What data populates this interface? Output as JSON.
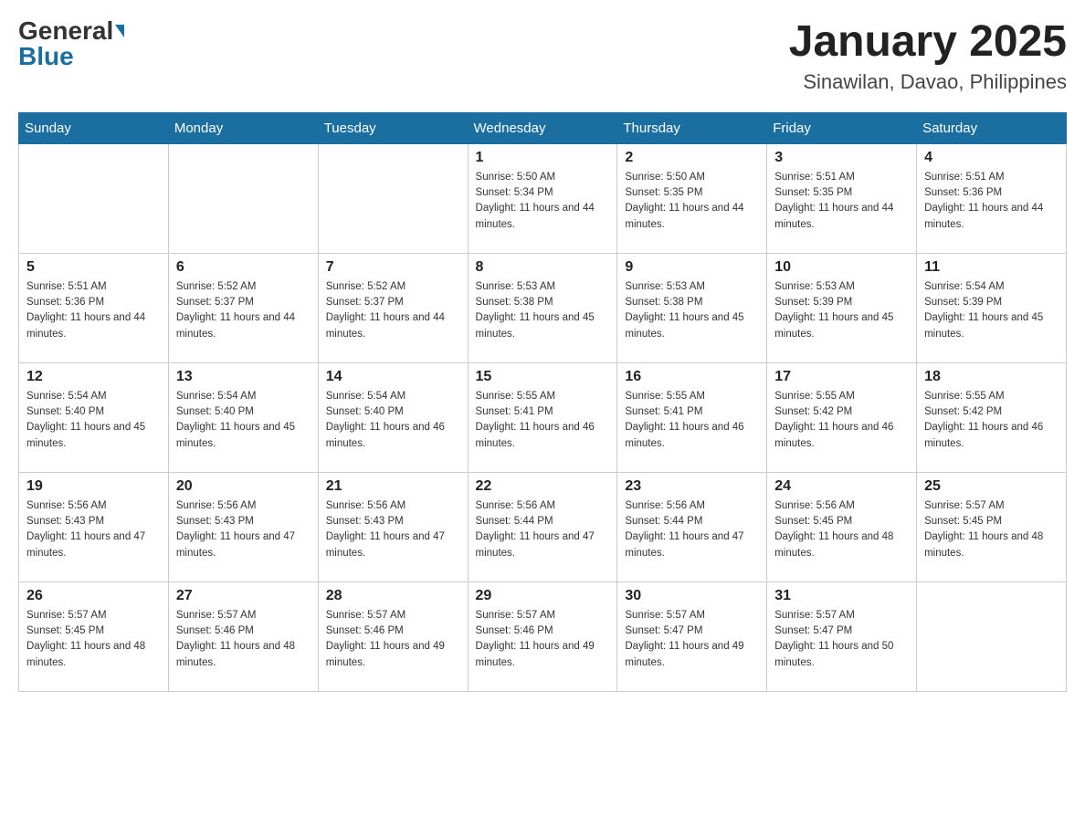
{
  "header": {
    "logo_general": "General",
    "logo_blue": "Blue",
    "month_title": "January 2025",
    "location": "Sinawilan, Davao, Philippines"
  },
  "days_of_week": [
    "Sunday",
    "Monday",
    "Tuesday",
    "Wednesday",
    "Thursday",
    "Friday",
    "Saturday"
  ],
  "weeks": [
    [
      {
        "day": "",
        "info": ""
      },
      {
        "day": "",
        "info": ""
      },
      {
        "day": "",
        "info": ""
      },
      {
        "day": "1",
        "info": "Sunrise: 5:50 AM\nSunset: 5:34 PM\nDaylight: 11 hours and 44 minutes."
      },
      {
        "day": "2",
        "info": "Sunrise: 5:50 AM\nSunset: 5:35 PM\nDaylight: 11 hours and 44 minutes."
      },
      {
        "day": "3",
        "info": "Sunrise: 5:51 AM\nSunset: 5:35 PM\nDaylight: 11 hours and 44 minutes."
      },
      {
        "day": "4",
        "info": "Sunrise: 5:51 AM\nSunset: 5:36 PM\nDaylight: 11 hours and 44 minutes."
      }
    ],
    [
      {
        "day": "5",
        "info": "Sunrise: 5:51 AM\nSunset: 5:36 PM\nDaylight: 11 hours and 44 minutes."
      },
      {
        "day": "6",
        "info": "Sunrise: 5:52 AM\nSunset: 5:37 PM\nDaylight: 11 hours and 44 minutes."
      },
      {
        "day": "7",
        "info": "Sunrise: 5:52 AM\nSunset: 5:37 PM\nDaylight: 11 hours and 44 minutes."
      },
      {
        "day": "8",
        "info": "Sunrise: 5:53 AM\nSunset: 5:38 PM\nDaylight: 11 hours and 45 minutes."
      },
      {
        "day": "9",
        "info": "Sunrise: 5:53 AM\nSunset: 5:38 PM\nDaylight: 11 hours and 45 minutes."
      },
      {
        "day": "10",
        "info": "Sunrise: 5:53 AM\nSunset: 5:39 PM\nDaylight: 11 hours and 45 minutes."
      },
      {
        "day": "11",
        "info": "Sunrise: 5:54 AM\nSunset: 5:39 PM\nDaylight: 11 hours and 45 minutes."
      }
    ],
    [
      {
        "day": "12",
        "info": "Sunrise: 5:54 AM\nSunset: 5:40 PM\nDaylight: 11 hours and 45 minutes."
      },
      {
        "day": "13",
        "info": "Sunrise: 5:54 AM\nSunset: 5:40 PM\nDaylight: 11 hours and 45 minutes."
      },
      {
        "day": "14",
        "info": "Sunrise: 5:54 AM\nSunset: 5:40 PM\nDaylight: 11 hours and 46 minutes."
      },
      {
        "day": "15",
        "info": "Sunrise: 5:55 AM\nSunset: 5:41 PM\nDaylight: 11 hours and 46 minutes."
      },
      {
        "day": "16",
        "info": "Sunrise: 5:55 AM\nSunset: 5:41 PM\nDaylight: 11 hours and 46 minutes."
      },
      {
        "day": "17",
        "info": "Sunrise: 5:55 AM\nSunset: 5:42 PM\nDaylight: 11 hours and 46 minutes."
      },
      {
        "day": "18",
        "info": "Sunrise: 5:55 AM\nSunset: 5:42 PM\nDaylight: 11 hours and 46 minutes."
      }
    ],
    [
      {
        "day": "19",
        "info": "Sunrise: 5:56 AM\nSunset: 5:43 PM\nDaylight: 11 hours and 47 minutes."
      },
      {
        "day": "20",
        "info": "Sunrise: 5:56 AM\nSunset: 5:43 PM\nDaylight: 11 hours and 47 minutes."
      },
      {
        "day": "21",
        "info": "Sunrise: 5:56 AM\nSunset: 5:43 PM\nDaylight: 11 hours and 47 minutes."
      },
      {
        "day": "22",
        "info": "Sunrise: 5:56 AM\nSunset: 5:44 PM\nDaylight: 11 hours and 47 minutes."
      },
      {
        "day": "23",
        "info": "Sunrise: 5:56 AM\nSunset: 5:44 PM\nDaylight: 11 hours and 47 minutes."
      },
      {
        "day": "24",
        "info": "Sunrise: 5:56 AM\nSunset: 5:45 PM\nDaylight: 11 hours and 48 minutes."
      },
      {
        "day": "25",
        "info": "Sunrise: 5:57 AM\nSunset: 5:45 PM\nDaylight: 11 hours and 48 minutes."
      }
    ],
    [
      {
        "day": "26",
        "info": "Sunrise: 5:57 AM\nSunset: 5:45 PM\nDaylight: 11 hours and 48 minutes."
      },
      {
        "day": "27",
        "info": "Sunrise: 5:57 AM\nSunset: 5:46 PM\nDaylight: 11 hours and 48 minutes."
      },
      {
        "day": "28",
        "info": "Sunrise: 5:57 AM\nSunset: 5:46 PM\nDaylight: 11 hours and 49 minutes."
      },
      {
        "day": "29",
        "info": "Sunrise: 5:57 AM\nSunset: 5:46 PM\nDaylight: 11 hours and 49 minutes."
      },
      {
        "day": "30",
        "info": "Sunrise: 5:57 AM\nSunset: 5:47 PM\nDaylight: 11 hours and 49 minutes."
      },
      {
        "day": "31",
        "info": "Sunrise: 5:57 AM\nSunset: 5:47 PM\nDaylight: 11 hours and 50 minutes."
      },
      {
        "day": "",
        "info": ""
      }
    ]
  ]
}
